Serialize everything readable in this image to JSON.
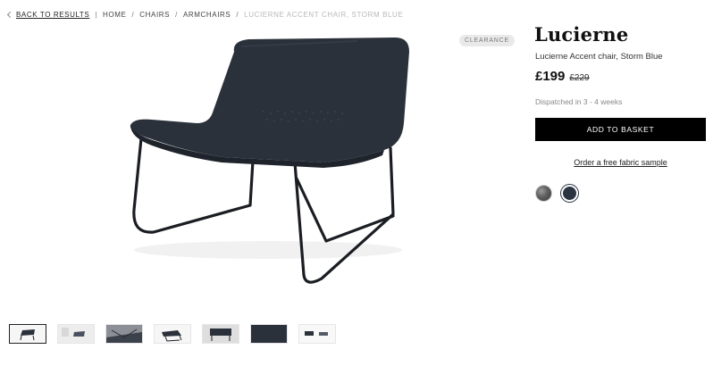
{
  "breadcrumb": {
    "back_label": "BACK TO RESULTS",
    "items": [
      "HOME",
      "CHAIRS",
      "ARMCHAIRS"
    ],
    "current": "LUCIERNE ACCENT CHAIR, STORM BLUE"
  },
  "badge": "CLEARANCE",
  "product": {
    "title": "Lucierne",
    "subtitle": "Lucierne Accent chair, Storm Blue",
    "price": "£199",
    "old_price": "£229",
    "dispatch": "Dispatched in 3 - 4 weeks",
    "add_to_basket": "ADD TO BASKET",
    "sample_link": "Order a free fabric sample"
  },
  "swatches": [
    {
      "name": "grey",
      "selected": false
    },
    {
      "name": "storm-blue",
      "selected": true
    }
  ],
  "colors": {
    "chair": "#2b313b",
    "frame": "#1a1d22",
    "button_bg": "#000000"
  },
  "thumbnails_count": 7
}
